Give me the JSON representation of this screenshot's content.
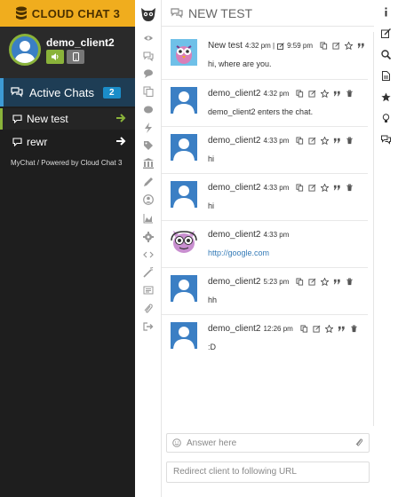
{
  "app": {
    "brand": "CLOUD CHAT 3"
  },
  "profile": {
    "name": "demo_client2"
  },
  "sidebar": {
    "active_chats_label": "Active Chats",
    "active_chats_count": "2",
    "chats": [
      {
        "label": "New test"
      },
      {
        "label": "rewr"
      }
    ],
    "footer": "MyChat / Powered by Cloud Chat 3"
  },
  "chat": {
    "title": "NEW TEST",
    "messages": [
      {
        "author": "New test",
        "time": "4:32 pm |",
        "edited_time": "9:59 pm",
        "text": "hi, where are you."
      },
      {
        "author": "demo_client2",
        "time": "4:32 pm",
        "text": "demo_client2 enters the chat."
      },
      {
        "author": "demo_client2",
        "time": "4:33 pm",
        "text": "hi"
      },
      {
        "author": "demo_client2",
        "time": "4:33 pm",
        "text": "hi"
      },
      {
        "author": "demo_client2",
        "time": "4:33 pm",
        "text": "http://google.com"
      },
      {
        "author": "demo_client2",
        "time": "5:23 pm",
        "text": "hh"
      },
      {
        "author": "demo_client2",
        "time": "12:26 pm",
        "text": ":D"
      }
    ],
    "answer_placeholder": "Answer here",
    "redirect_placeholder": "Redirect client to following URL"
  },
  "colors": {
    "brand_bg": "#f0ad1e",
    "accent_green": "#8ab33a",
    "accent_blue": "#1b8dc9",
    "sidebar_bg": "#1e1e1e"
  },
  "icons": {
    "iconbar": [
      "eye-icon",
      "comments-icon",
      "comment-icon",
      "copy-icon",
      "comment-bubble-icon",
      "bolt-icon",
      "tag-icon",
      "bank-icon",
      "pencil-icon",
      "user-circle-icon",
      "area-chart-icon",
      "gear-icon",
      "code-icon",
      "magic-wand-icon",
      "newspaper-icon",
      "paperclip-icon",
      "sign-out-icon"
    ],
    "rightbar": [
      "info-icon",
      "edit-icon",
      "search-icon",
      "file-icon",
      "star-icon",
      "lightbulb-icon",
      "comments-icon"
    ]
  }
}
